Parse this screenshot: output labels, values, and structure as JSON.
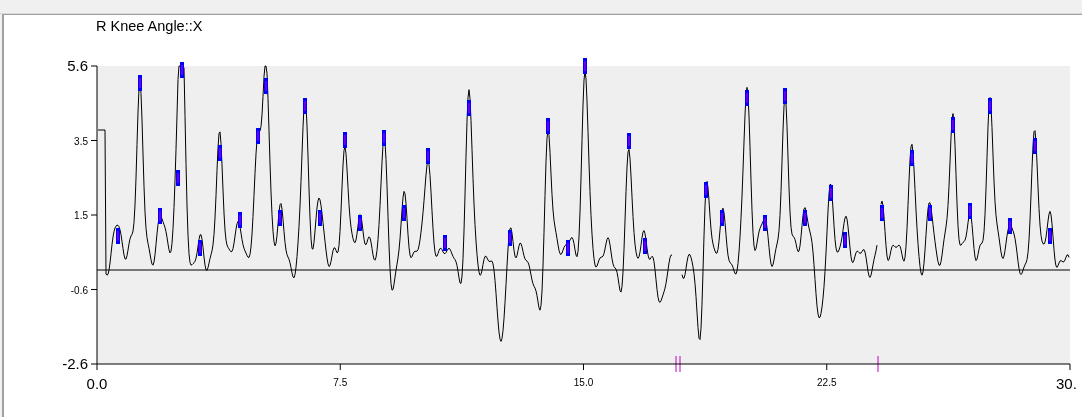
{
  "plot": {
    "title": "R Knee Angle::X",
    "y_ticks": [
      {
        "label": "5.6",
        "major": true
      },
      {
        "label": "3.5",
        "major": false
      },
      {
        "label": "1.5",
        "major": false
      },
      {
        "label": "-0.6",
        "major": false
      },
      {
        "label": "-2.6",
        "major": true
      }
    ],
    "x_ticks": [
      {
        "label": "0.0",
        "major": true
      },
      {
        "label": "7.5",
        "major": false
      },
      {
        "label": "15.0",
        "major": false
      },
      {
        "label": "22.5",
        "major": false
      },
      {
        "label": "30.",
        "major": true
      }
    ]
  }
}
